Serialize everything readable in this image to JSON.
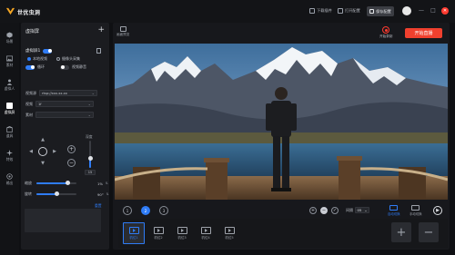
{
  "app": {
    "title": "世优虫洞"
  },
  "header": {
    "download_label": "下载插件",
    "open_label": "打开配置",
    "save_label": "保存配置",
    "window_controls": [
      "—",
      "□",
      "✕"
    ]
  },
  "sidebar": {
    "items": [
      {
        "label": "场景",
        "icon": "cube-icon"
      },
      {
        "label": "素材",
        "icon": "image-icon"
      },
      {
        "label": "虚拟人",
        "icon": "person-icon"
      },
      {
        "label": "虚拟屏",
        "icon": "screen-icon",
        "active": true
      },
      {
        "label": "道具",
        "icon": "box-icon"
      },
      {
        "label": "特效",
        "icon": "sparkle-icon"
      },
      {
        "label": "输出",
        "icon": "output-icon"
      }
    ]
  },
  "panel": {
    "title": "虚拟屏",
    "add_symbol": "+",
    "screen_name": "虚拟屏1",
    "source_options": [
      {
        "label": "本地视频",
        "selected": true
      },
      {
        "label": "摄像头采集",
        "selected": false
      }
    ],
    "loop_label": "循环",
    "mute_label": "视频静音",
    "fields": [
      {
        "label": "视频源",
        "value": "rtsp://xxx.xx.xx",
        "chevron": "⌄"
      },
      {
        "label": "视频",
        "value": "1f",
        "chevron": "⌄"
      },
      {
        "label": "素材",
        "value": "",
        "chevron": "⌄"
      }
    ],
    "dpad_arrows": [
      "▲",
      "▼",
      "◀",
      "▶"
    ],
    "zoom_in_symbol": "+",
    "zoom_out_symbol": "−",
    "depth_label": "深度",
    "depth_value": "15",
    "depth_level": 0.35,
    "scale_label": "缩放",
    "scale_value": "1%",
    "scale_level": 0.78,
    "rotate_label": "旋转",
    "rotate_value": "90°",
    "rotate_level": 0.5,
    "reset_label": "重置"
  },
  "stage": {
    "tab_label": "画面预览",
    "record_label": "开始录制",
    "live_button": "开始直播"
  },
  "timeline": {
    "scene_numbers": [
      "1",
      "2",
      "3"
    ],
    "active_scene": "2",
    "add_symbol": "+",
    "minus_symbol": "−",
    "check_symbol": "✓",
    "interval_label": "间隔",
    "interval_value": "05",
    "interval_chevron": "⌄",
    "auto_switch_label": "自动切换",
    "manual_switch_label": "手动切换",
    "play_symbol": "▶"
  },
  "shots": {
    "items": [
      {
        "label": "机位1",
        "active": true
      },
      {
        "label": "机位2",
        "active": false
      },
      {
        "label": "机位3",
        "active": false
      },
      {
        "label": "机位4",
        "active": false
      },
      {
        "label": "机位5",
        "active": false
      }
    ],
    "add_symbol": "+",
    "remove_symbol": "−"
  },
  "colors": {
    "accent": "#2f7cf6",
    "live": "#f0402e",
    "background": "#0f1013",
    "panel": "#1b1c20"
  }
}
